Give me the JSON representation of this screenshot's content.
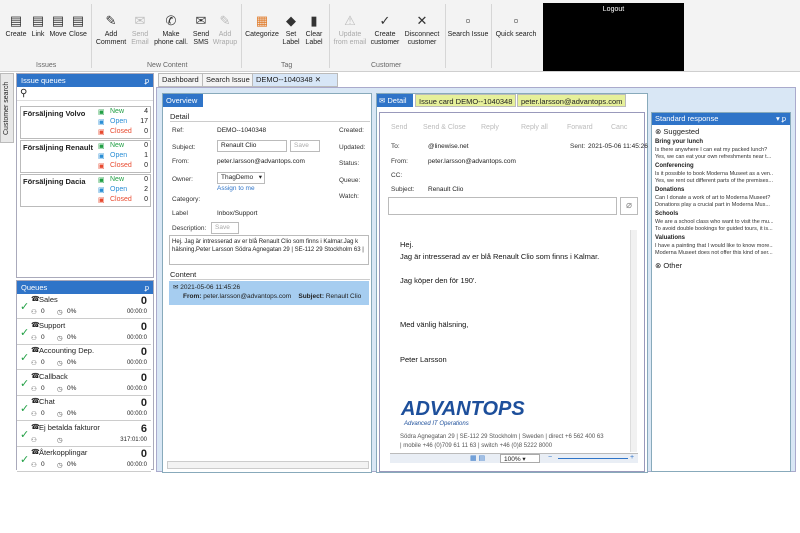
{
  "ribbon": {
    "issues": {
      "group": "Issues",
      "create": "Create",
      "link": "Link",
      "move": "Move",
      "close": "Close"
    },
    "new_content": {
      "group": "New Content",
      "add_comment": "Add Comment",
      "send_email": "Send Email",
      "make_call": "Make phone call.",
      "send_sms": "Send SMS",
      "add_wrapup": "Add Wrapup"
    },
    "tag": {
      "group": "Tag",
      "categorize": "Categorize",
      "set_label": "Set Label",
      "clear_label": "Clear Label"
    },
    "customer": {
      "group": "Customer",
      "update": "Update from email",
      "create": "Create customer",
      "disconnect": "Disconnect customer"
    },
    "search_issue": "Search Issue",
    "quick_search": "Quick search",
    "logout": "Logout"
  },
  "sidebar": {
    "customer_search": "Customer search",
    "issue_queues_title": "Issue queues",
    "issue_queues": [
      {
        "name": "Försäljning Volvo",
        "new_label": "New",
        "new": "4",
        "open_label": "Open",
        "open": "17",
        "closed_label": "Closed",
        "closed": "0"
      },
      {
        "name": "Försäljning Renault",
        "new_label": "New",
        "new": "0",
        "open_label": "Open",
        "open": "1",
        "closed_label": "Closed",
        "closed": "0"
      },
      {
        "name": "Försäljning Dacia",
        "new_label": "New",
        "new": "0",
        "open_label": "Open",
        "open": "2",
        "closed_label": "Closed",
        "closed": "0"
      }
    ],
    "queues_title": "Queues",
    "queues": [
      {
        "name": "Sales",
        "count": "0",
        "pct": "0%",
        "time": "00:00:0",
        "agents": "0"
      },
      {
        "name": "Support",
        "count": "0",
        "pct": "0%",
        "time": "00:00:0",
        "agents": "0"
      },
      {
        "name": "Accounting Dep.",
        "count": "0",
        "pct": "0%",
        "time": "00:00:0",
        "agents": "0"
      },
      {
        "name": "Callback",
        "count": "0",
        "pct": "0%",
        "time": "00:00:0",
        "agents": "0"
      },
      {
        "name": "Chat",
        "count": "0",
        "pct": "0%",
        "time": "00:00:0",
        "agents": "0"
      },
      {
        "name": "Ej betalda fakturor",
        "count": "6",
        "pct": "",
        "time": "317:01:00",
        "agents": ""
      },
      {
        "name": "Återkopplingar",
        "count": "0",
        "pct": "0%",
        "time": "00:00:0",
        "agents": "0"
      }
    ]
  },
  "tabs": {
    "dashboard": "Dashboard",
    "search_issue": "Search Issue",
    "demo": "DEMO--1040348"
  },
  "overview": {
    "title": "Overview",
    "detail": "Detail",
    "ref_label": "Ref:",
    "ref": "DEMO--1040348",
    "subject_label": "Subject:",
    "subject": "Renault Clio",
    "save": "Save",
    "from_label": "From:",
    "from": "peter.larsson@advantops.com",
    "owner_label": "Owner:",
    "owner": "ThagDemo",
    "assign": "Assign to me",
    "category_label": "Category:",
    "label_label": "Label",
    "label": "Inbox/Support",
    "desc_label": "Description:",
    "desc_save": "Save",
    "created_label": "Created:",
    "updated_label": "Updated:",
    "status_label": "Status:",
    "queue_label": "Queue:",
    "watch_label": "Watch:",
    "description_text": "Hej. Jag är intresserad av er blå Renault Clio som finns i Kalmar.Jag k hälsning,Peter Larsson Södra Agnegatan 29 | SE-112 29 Stockholm 63 |",
    "content": "Content",
    "content_date": "2021-05-06 11:45:26",
    "content_from_label": "From:",
    "content_from": "peter.larsson@advantops.com",
    "content_subject_label": "Subject:",
    "content_subject": "Renault Clio"
  },
  "detail": {
    "tab_detail": "Detail",
    "tab_card": "Issue card DEMO--1040348",
    "tab_email": "peter.larsson@advantops.com",
    "toolbar": [
      "Send",
      "Send & Close",
      "Reply",
      "Reply all",
      "Forward",
      "Canc"
    ],
    "to_label": "To:",
    "to": "@linewise.net",
    "sent_label": "Sent:",
    "sent": "2021-05-06 11:45:26",
    "from_label": "From:",
    "from": "peter.larsson@advantops.com",
    "cc_label": "CC:",
    "subject_label": "Subject:",
    "subject": "Renault Clio",
    "body": [
      "Hej.",
      "Jag är intresserad av er blå Renault Clio som finns i Kalmar.",
      "Jag köper den för 190'.",
      "Med vänlig hälsning,",
      "Peter Larsson"
    ],
    "logo": "ADVANTOPS",
    "logo_sub": "Advanced IT Operations",
    "footer1": "Södra Agnegatan 29 | SE-112 29 Stockholm | Sweden | direct +6 562 400 63",
    "footer2": "| mobile +46 (0)709 61 11 63 | switch +46 (0)8 5222 8000",
    "zoom": "100%"
  },
  "standard": {
    "title": "Standard response",
    "suggested": "Suggested",
    "groups": [
      {
        "title": "Bring your lunch",
        "items": [
          "Is there anywhere I can eat my packed lunch?",
          "Yes, we can eat your own refreshments near t..."
        ]
      },
      {
        "title": "Conferencing",
        "items": [
          "Is it possible to book Moderna Museet as a ven...",
          "Yes, we rent out different parts of the premises..."
        ]
      },
      {
        "title": "Donations",
        "items": [
          "Can I donate a work of art to Moderna Museet?",
          "Donations play a crucial part in Moderna Mus..."
        ]
      },
      {
        "title": "Schools",
        "items": [
          "We are a school class who want to visit the mu...",
          "To avoid double bookings for guided tours, it is..."
        ]
      },
      {
        "title": "Valuations",
        "items": [
          "I have a painting that I would like to know more...",
          "Moderna Museet does not offer this kind of ser..."
        ]
      }
    ],
    "other": "Other"
  },
  "colors": {
    "accent": "#2f74c8",
    "new": "#22a045",
    "open": "#2b8fd6",
    "closed": "#e84a2f"
  }
}
